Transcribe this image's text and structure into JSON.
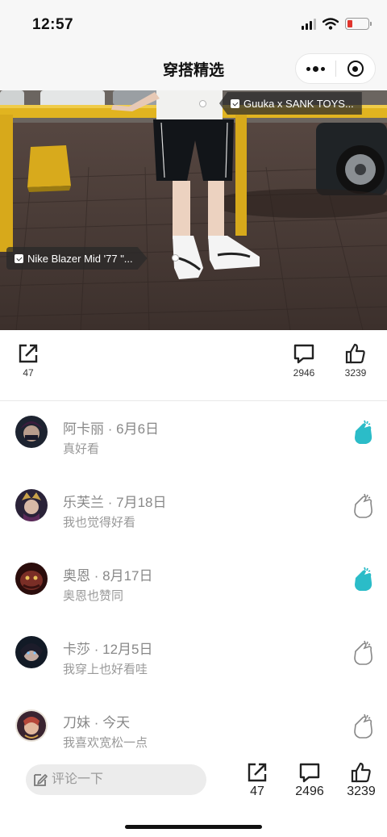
{
  "status_bar": {
    "time": "12:57",
    "icons": [
      "signal-icon",
      "wifi-icon",
      "battery-icon"
    ]
  },
  "nav": {
    "title": "穿搭精选",
    "more_icon": "more-dots-icon",
    "close_icon": "target-close-icon"
  },
  "photo": {
    "tags": [
      {
        "label": "Guuka x SANK TOYS..."
      },
      {
        "label": "Nike Blazer Mid '77 \"..."
      }
    ]
  },
  "stats": {
    "share_count": "47",
    "comment_count": "2946",
    "like_count": "3239"
  },
  "comments": [
    {
      "name": "阿卡丽",
      "date": "6月6日",
      "text": "真好看",
      "liked": true
    },
    {
      "name": "乐芙兰",
      "date": "7月18日",
      "text": "我也觉得好看",
      "liked": false
    },
    {
      "name": "奥恩",
      "date": "8月17日",
      "text": "奥恩也赞同",
      "liked": true
    },
    {
      "name": "卡莎",
      "date": "12月5日",
      "text": "我穿上也好看哇",
      "liked": false
    },
    {
      "name": "刀妹",
      "date": "今天",
      "text": "我喜欢宽松一点",
      "liked": false
    }
  ],
  "bottom_bar": {
    "input_placeholder": "评论一下",
    "share_count": "47",
    "comment_count": "2496",
    "like_count": "3239"
  },
  "colors": {
    "accent": "#2bbcc8",
    "muted_text": "#999999",
    "background": "#f7f7f7"
  }
}
